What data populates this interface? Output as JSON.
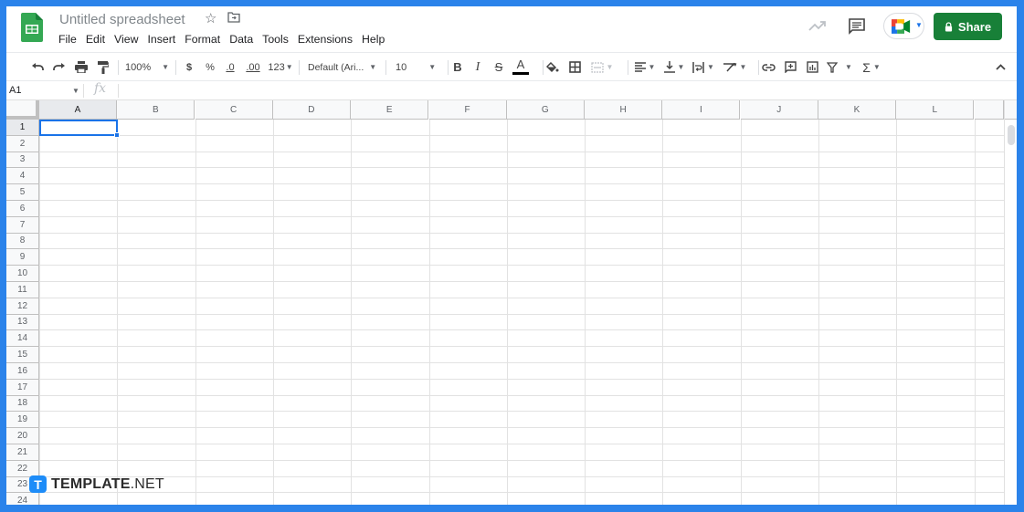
{
  "app": {
    "title": "Untitled spreadsheet",
    "menu": [
      "File",
      "Edit",
      "View",
      "Insert",
      "Format",
      "Data",
      "Tools",
      "Extensions",
      "Help"
    ],
    "share_label": "Share",
    "colors": {
      "brand": "#34a853",
      "share": "#188038",
      "selection": "#1a73e8",
      "frame": "#2b83ea"
    }
  },
  "toolbar": {
    "zoom": "100%",
    "currency": "$",
    "percent": "%",
    "decrease_decimal": ".0",
    "increase_decimal": ".00",
    "more_formats": "123",
    "font": "Default (Ari...",
    "font_size": "10",
    "icons": [
      "undo-icon",
      "redo-icon",
      "print-icon",
      "paint-format-icon",
      "bold-icon",
      "italic-icon",
      "strikethrough-icon",
      "text-color-icon",
      "fill-color-icon",
      "borders-icon",
      "merge-cells-icon",
      "horizontal-align-icon",
      "vertical-align-icon",
      "text-wrap-icon",
      "text-rotation-icon",
      "insert-link-icon",
      "insert-comment-icon",
      "insert-chart-icon",
      "filter-icon",
      "functions-icon",
      "collapse-toolbar-icon"
    ]
  },
  "formula_bar": {
    "name_box": "A1",
    "fx_label": "fx",
    "value": ""
  },
  "sheet": {
    "columns": [
      "A",
      "B",
      "C",
      "D",
      "E",
      "F",
      "G",
      "H",
      "I",
      "J",
      "K",
      "L"
    ],
    "rows": [
      "1",
      "2",
      "3",
      "4",
      "5",
      "6",
      "7",
      "8",
      "9",
      "10",
      "11",
      "12",
      "13",
      "14",
      "15",
      "16",
      "17",
      "18",
      "19",
      "20",
      "21",
      "22",
      "23",
      "24"
    ],
    "selected_cell": "A1"
  },
  "watermark": {
    "logo_letter": "T",
    "bold": "TEMPLATE",
    "light": ".NET"
  }
}
